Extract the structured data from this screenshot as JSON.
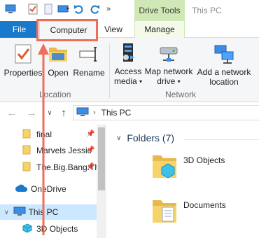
{
  "window": {
    "title": "This PC",
    "context_tab_group": "Drive Tools"
  },
  "quick_access": [
    {
      "icon": "computer-icon"
    },
    {
      "icon": "properties-check-icon"
    },
    {
      "icon": "new-file-icon"
    },
    {
      "icon": "new-folder-icon"
    },
    {
      "icon": "undo-icon"
    },
    {
      "icon": "redo-icon"
    },
    {
      "icon": "more-chevron-icon",
      "label": "»"
    }
  ],
  "ribbon_tabs": {
    "file": "File",
    "computer": "Computer",
    "view": "View",
    "manage": "Manage"
  },
  "ribbon": {
    "location_group": {
      "label": "Location",
      "properties": "Properties",
      "open": "Open",
      "rename": "Rename"
    },
    "network_group": {
      "label": "Network",
      "access_media": "Access",
      "access_media_2": "media",
      "map_network_drive": "Map network",
      "map_network_drive_2": "drive",
      "add_network_location": "Add a network",
      "add_network_location_2": "location"
    }
  },
  "address_bar": {
    "path": "This PC",
    "back_arrow": "←",
    "forward_arrow": "→",
    "recent_chevron": "∨",
    "up_arrow": "↑"
  },
  "nav_pane": {
    "pinned": [
      {
        "label": "final"
      },
      {
        "label": "Marvels Jessic"
      },
      {
        "label": "The.Big.Bang.Th"
      }
    ],
    "onedrive": "OneDrive",
    "this_pc": "This PC",
    "objects_3d": "3D Objects"
  },
  "content": {
    "section_title": "Folders (7)",
    "folders": [
      {
        "name": "3D Objects"
      },
      {
        "name": "Documents"
      }
    ]
  },
  "colors": {
    "file_tab": "#1979ca",
    "drive_tools": "#cfe8b5",
    "annotation": "#ef6e5a",
    "selection": "#cce8ff"
  }
}
